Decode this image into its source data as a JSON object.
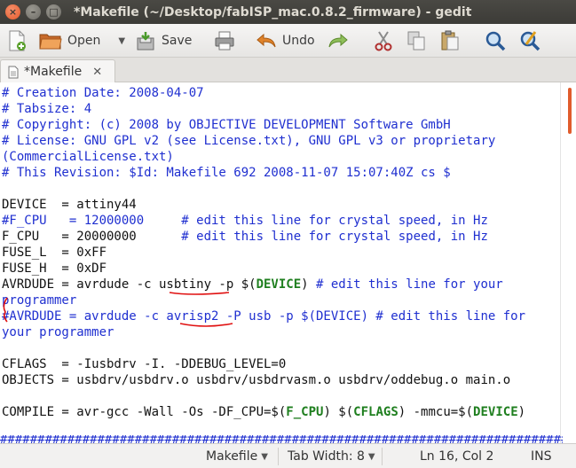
{
  "window": {
    "title": "*Makefile (~/Desktop/fabISP_mac.0.8.2_firmware) - gedit",
    "close_glyph": "×",
    "minimize_glyph": "–",
    "maximize_glyph": "□"
  },
  "toolbar": {
    "open_label": "Open",
    "save_label": "Save",
    "undo_label": "Undo",
    "icons": [
      "new-document-icon",
      "open-folder-icon",
      "save-icon",
      "print-icon",
      "undo-icon",
      "redo-icon",
      "cut-icon",
      "copy-icon",
      "paste-icon",
      "find-icon",
      "find-replace-icon"
    ]
  },
  "tab": {
    "label": "*Makefile",
    "close_glyph": "✕"
  },
  "editor": {
    "lines": [
      "# Creation Date: 2008-04-07",
      "# Tabsize: 4",
      "# Copyright: (c) 2008 by OBJECTIVE DEVELOPMENT Software GmbH",
      "# License: GNU GPL v2 (see License.txt), GNU GPL v3 or proprietary",
      "(CommercialLicense.txt)",
      "# This Revision: $Id: Makefile 692 2008-11-07 15:07:40Z cs $",
      "",
      "DEVICE  = attiny44",
      "#F_CPU   = 12000000     # edit this line for crystal speed, in Hz",
      "F_CPU   = 20000000      # edit this line for crystal speed, in Hz",
      "FUSE_L  = 0xFF",
      "FUSE_H  = 0xDF",
      "AVRDUDE = avrdude -c usbtiny -p $(DEVICE) # edit this line for your",
      "programmer",
      "#AVRDUDE = avrdude -c avrisp2 -P usb -p $(DEVICE) # edit this line for",
      "your programmer",
      "",
      "CFLAGS  = -Iusbdrv -I. -DDEBUG_LEVEL=0",
      "OBJECTS = usbdrv/usbdrv.o usbdrv/usbdrvasm.o usbdrv/oddebug.o main.o",
      "",
      "COMPILE = avr-gcc -Wall -Os -DF_CPU=$(F_CPU) $(CFLAGS) -mmcu=$(DEVICE)"
    ],
    "bottom_rule": "################################################################################",
    "colors": {
      "comment": "#1f2fd0",
      "keyword": "#1f7f1f",
      "annotation": "#e01010",
      "scrollbar": "#e05c2c"
    }
  },
  "statusbar": {
    "language": "Makefile",
    "tab_width": "Tab Width: 8",
    "position": "Ln 16, Col 2",
    "mode": "INS",
    "dropdown_glyph": "▼"
  }
}
